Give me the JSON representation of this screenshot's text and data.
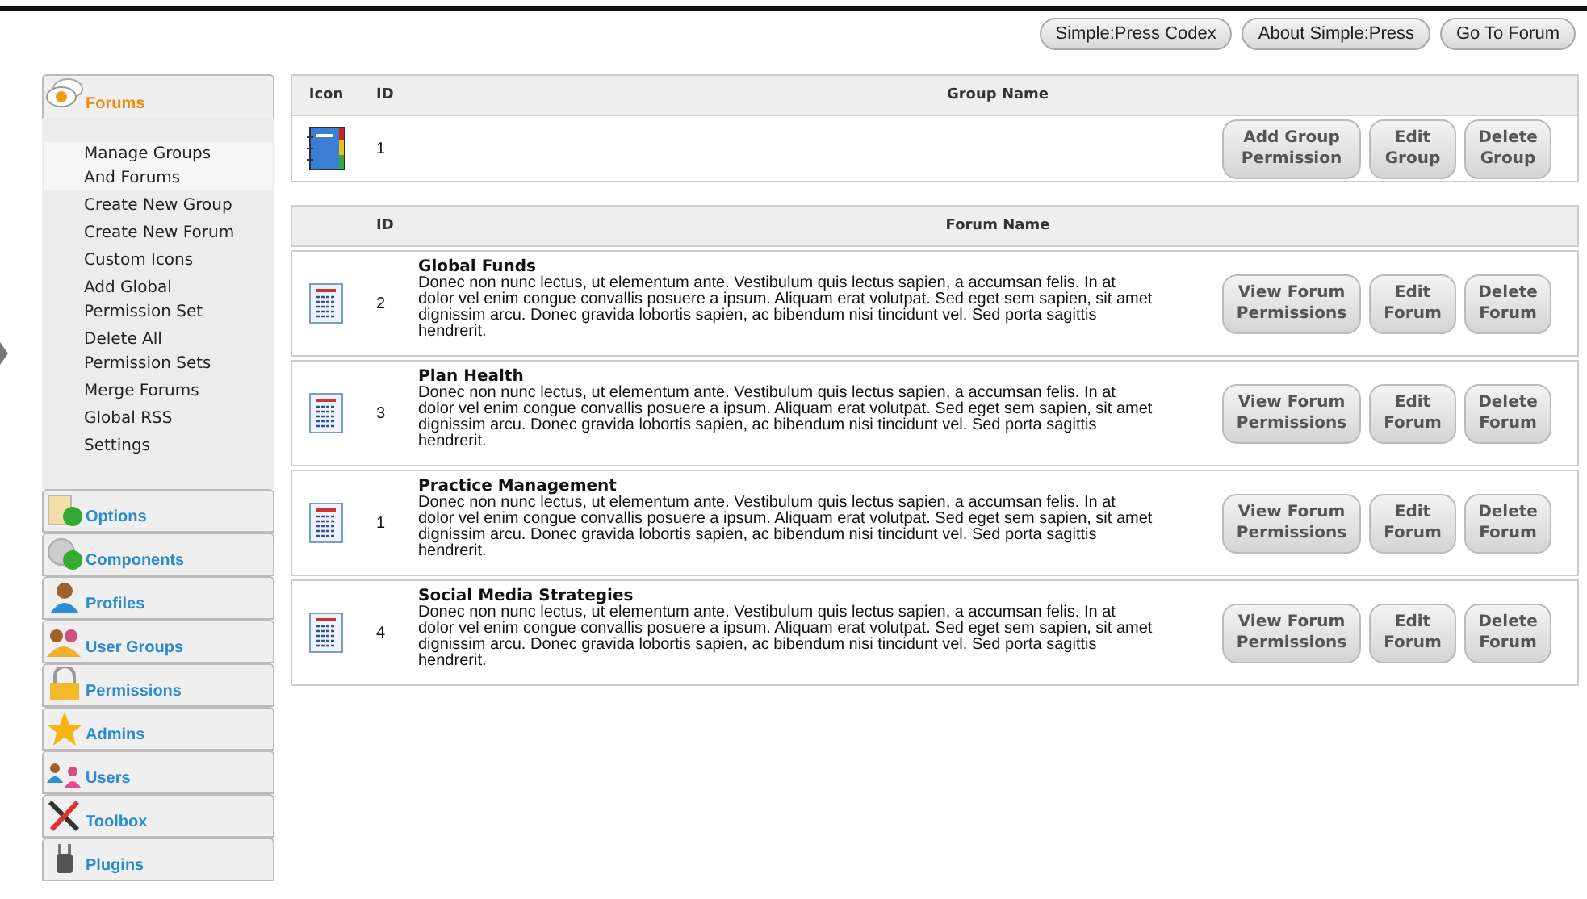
{
  "top_buttons": [
    "Simple:Press Codex",
    "About Simple:Press",
    "Go To Forum"
  ],
  "sidebar": {
    "sections": [
      {
        "label": "Forums",
        "expanded": true,
        "children": [
          {
            "label": "Manage Groups And Forums",
            "selected": true
          },
          {
            "label": "Create New Group",
            "selected": false
          },
          {
            "label": "Create New Forum",
            "selected": false
          },
          {
            "label": "Custom Icons",
            "selected": false
          },
          {
            "label": "Add Global Permission Set",
            "selected": false
          },
          {
            "label": "Delete All Permission Sets",
            "selected": false
          },
          {
            "label": "Merge Forums",
            "selected": false
          },
          {
            "label": "Global RSS",
            "selected": false
          },
          {
            "label": "Settings",
            "selected": false
          }
        ]
      },
      {
        "label": "Options",
        "expanded": false
      },
      {
        "label": "Components",
        "expanded": false
      },
      {
        "label": "Profiles",
        "expanded": false
      },
      {
        "label": "User Groups",
        "expanded": false
      },
      {
        "label": "Permissions",
        "expanded": false
      },
      {
        "label": "Admins",
        "expanded": false
      },
      {
        "label": "Users",
        "expanded": false
      },
      {
        "label": "Toolbox",
        "expanded": false
      },
      {
        "label": "Plugins",
        "expanded": false
      }
    ]
  },
  "group_table": {
    "columns": [
      "Icon",
      "ID",
      "Group Name"
    ],
    "rows": [
      {
        "id": "1",
        "buttons": [
          "Add Group Permission",
          "Edit Group",
          "Delete Group"
        ]
      }
    ]
  },
  "forum_table": {
    "columns": [
      "ID",
      "Forum Name"
    ],
    "rows": [
      {
        "id": "2",
        "name": "Global Funds",
        "description": "Donec non nunc lectus, ut elementum ante. Vestibulum quis lectus sapien, a accumsan felis. In at dolor vel enim congue convallis posuere a ipsum. Aliquam erat volutpat. Sed eget sem sapien, sit amet dignissim arcu. Donec gravida lobortis sapien, ac bibendum nisi tincidunt vel. Sed porta sagittis hendrerit.",
        "buttons": [
          "View Forum Permissions",
          "Edit Forum",
          "Delete Forum"
        ]
      },
      {
        "id": "3",
        "name": "Plan Health",
        "description": "Donec non nunc lectus, ut elementum ante. Vestibulum quis lectus sapien, a accumsan felis. In at dolor vel enim congue convallis posuere a ipsum. Aliquam erat volutpat. Sed eget sem sapien, sit amet dignissim arcu. Donec gravida lobortis sapien, ac bibendum nisi tincidunt vel. Sed porta sagittis hendrerit.",
        "buttons": [
          "View Forum Permissions",
          "Edit Forum",
          "Delete Forum"
        ]
      },
      {
        "id": "1",
        "name": "Practice Management",
        "description": "Donec non nunc lectus, ut elementum ante. Vestibulum quis lectus sapien, a accumsan felis. In at dolor vel enim congue convallis posuere a ipsum. Aliquam erat volutpat. Sed eget sem sapien, sit amet dignissim arcu. Donec gravida lobortis sapien, ac bibendum nisi tincidunt vel. Sed porta sagittis hendrerit.",
        "buttons": [
          "View Forum Permissions",
          "Edit Forum",
          "Delete Forum"
        ]
      },
      {
        "id": "4",
        "name": "Social Media Strategies",
        "description": "Donec non nunc lectus, ut elementum ante. Vestibulum quis lectus sapien, a accumsan felis. In at dolor vel enim congue convallis posuere a ipsum. Aliquam erat volutpat. Sed eget sem sapien, sit amet dignissim arcu. Donec gravida lobortis sapien, ac bibendum nisi tincidunt vel. Sed porta sagittis hendrerit.",
        "buttons": [
          "View Forum Permissions",
          "Edit Forum",
          "Delete Forum"
        ]
      }
    ]
  }
}
